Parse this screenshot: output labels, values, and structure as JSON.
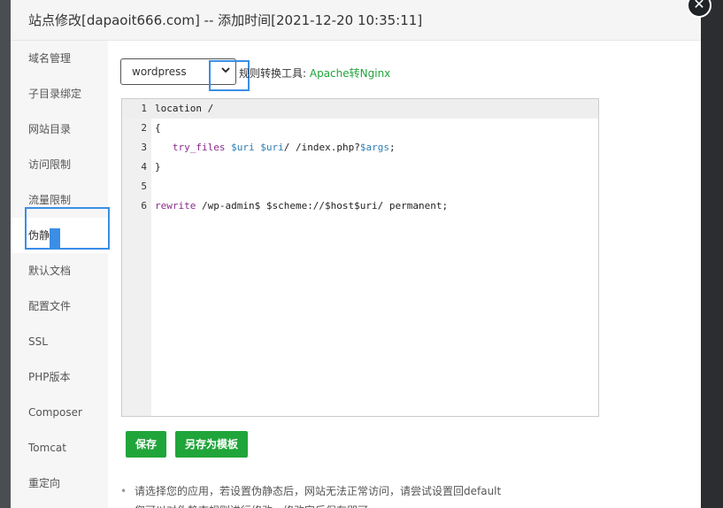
{
  "dialog": {
    "title": "站点修改[dapaoit666.com] -- 添加时间[2021-12-20 10:35:11]",
    "close_glyph": "✕"
  },
  "sidebar": {
    "items": [
      {
        "label": "域名管理"
      },
      {
        "label": "子目录绑定"
      },
      {
        "label": "网站目录"
      },
      {
        "label": "访问限制"
      },
      {
        "label": "流量限制"
      },
      {
        "label": "伪静态",
        "active": true
      },
      {
        "label": "默认文档"
      },
      {
        "label": "配置文件"
      },
      {
        "label": "SSL"
      },
      {
        "label": "PHP版本"
      },
      {
        "label": "Composer"
      },
      {
        "label": "Tomcat"
      },
      {
        "label": "重定向"
      }
    ]
  },
  "rewrite": {
    "template_select_value": "wordpress",
    "rule_label": "规则转换工具:",
    "rule_link": "Apache转Nginx"
  },
  "editor": {
    "line_numbers": [
      "1",
      "2",
      "3",
      "4",
      "5",
      "6"
    ],
    "lines": {
      "l1": "location /",
      "l2": "{",
      "l3_a": "   ",
      "l3_kw": "try_files",
      "l3_b": " ",
      "l3_v1": "$uri",
      "l3_c": " ",
      "l3_v2": "$uri",
      "l3_d": "/ /index.php?",
      "l3_v3": "$args",
      "l3_e": ";",
      "l4": "}",
      "l5": "",
      "l6_kw": "rewrite",
      "l6_a": " /wp-admin$ $scheme://$host$uri/ permanent;"
    }
  },
  "buttons": {
    "save": "保存",
    "save_as_template": "另存为模板"
  },
  "tips": [
    "请选择您的应用，若设置伪静态后，网站无法正常访问，请尝试设置回default",
    "您可以对伪静态规则进行修改，修改完后保存即可。"
  ],
  "colors": {
    "accent_green": "#20a53a",
    "annotation_blue": "#3a8ee6"
  }
}
